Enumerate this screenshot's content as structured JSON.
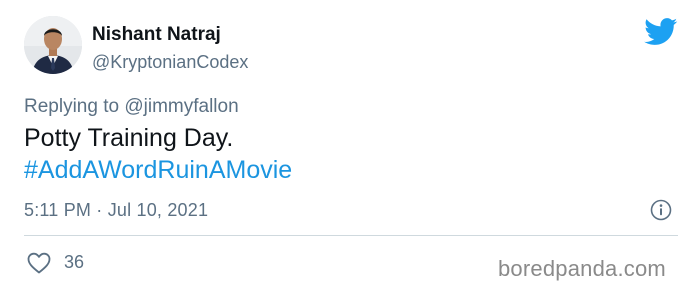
{
  "author": {
    "name": "Nishant Natraj",
    "handle": "@KryptonianCodex"
  },
  "reply": {
    "prefix": "Replying to",
    "mention": "@jimmyfallon"
  },
  "tweet": {
    "text": "Potty Training Day.",
    "hashtag": "#AddAWordRuinAMovie",
    "timestamp": "5:11 PM · Jul 10, 2021"
  },
  "stats": {
    "likes": "36"
  },
  "watermark": "boredpanda.com",
  "icons": {
    "brand": "twitter-bird-icon",
    "info": "info-icon",
    "like": "heart-icon"
  },
  "colors": {
    "brand_blue": "#1da1f2",
    "hashtag_blue": "#1b95e0",
    "secondary_text": "#5b7083",
    "primary_text": "#0f1419",
    "divider": "#cfd9de"
  }
}
